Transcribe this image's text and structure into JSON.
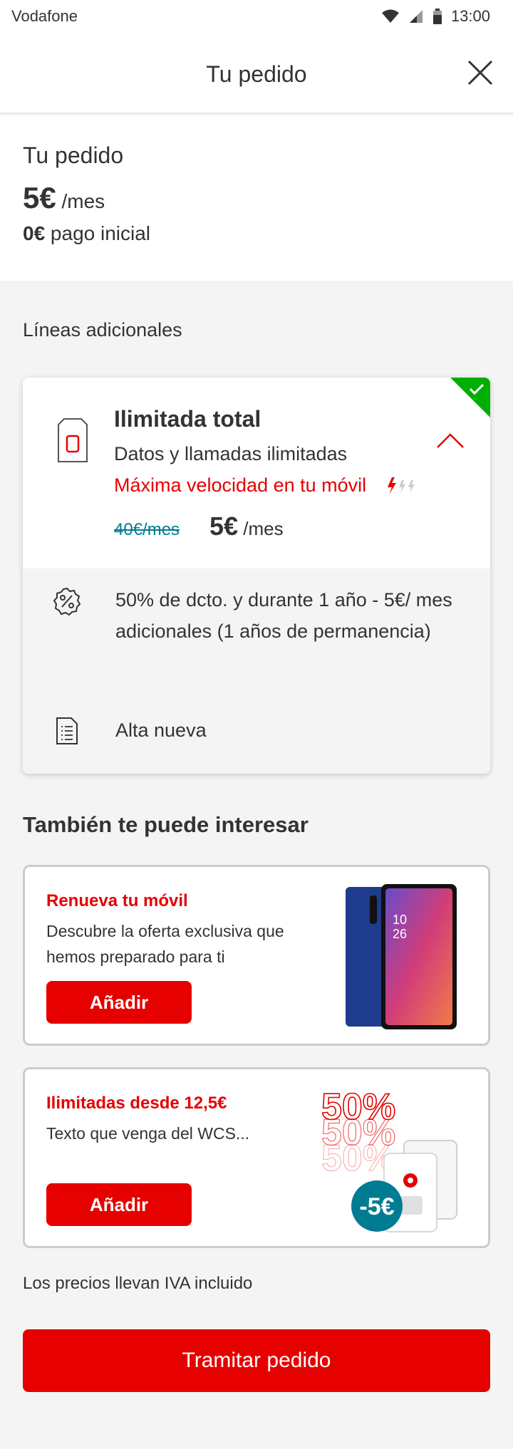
{
  "status_bar": {
    "carrier": "Vodafone",
    "time": "13:00"
  },
  "header": {
    "title": "Tu pedido"
  },
  "summary": {
    "title": "Tu pedido",
    "monthly_amount": "5€",
    "monthly_unit": " /mes",
    "initial_amount": "0€",
    "initial_label": " pago inicial"
  },
  "additional_lines": {
    "section_label": "Líneas adicionales",
    "plan": {
      "name": "Ilimitada total",
      "description": "Datos y llamadas ilimitadas",
      "speed": "Máxima velocidad en tu móvil",
      "old_price": "40€/mes",
      "new_price": "5€",
      "new_price_unit": " /mes",
      "selected": true
    },
    "discount_text": "50% de dcto. y durante 1 año - 5€/ mes adicionales (1 años de permanencia)",
    "contract_type": "Alta nueva"
  },
  "interest": {
    "title": "También te puede interesar",
    "offers": [
      {
        "title": "Renueva  tu móvil",
        "description": "Descubre la oferta exclusiva que hemos preparado para ti",
        "button_label": "Añadir",
        "phone_screen_time": "10\n26"
      },
      {
        "title": "Ilimitadas desde 12,5€",
        "description": "Texto que venga del WCS...",
        "button_label": "Añadir",
        "badge_percent": "50%",
        "badge_discount": "-5€"
      }
    ]
  },
  "footer": {
    "vat_note": "Los precios llevan IVA incluido",
    "checkout_label": "Tramitar pedido"
  },
  "colors": {
    "brand_red": "#e60000",
    "check_green": "#00b000",
    "teal": "#007c92"
  }
}
